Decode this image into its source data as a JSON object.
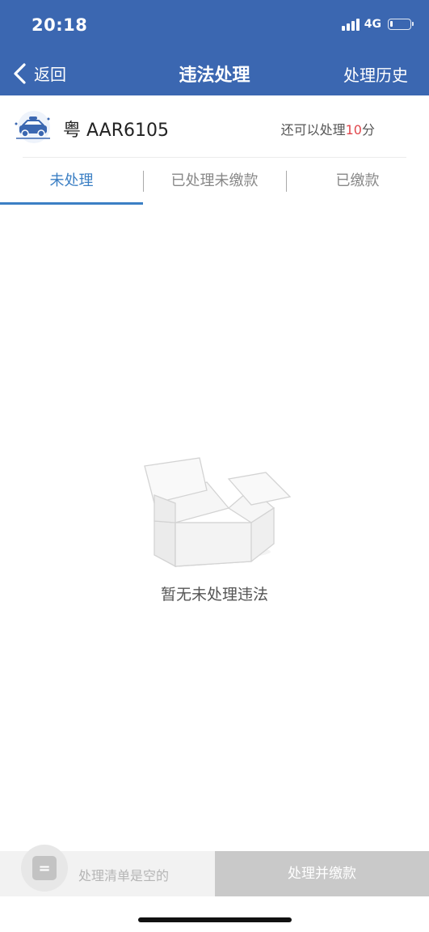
{
  "status_bar": {
    "time": "20:18",
    "network": "4G"
  },
  "nav": {
    "back_label": "返回",
    "title": "违法处理",
    "history_label": "处理历史"
  },
  "vehicle": {
    "plate": "粤 AAR6105",
    "points_prefix": "还可以处理",
    "points_value": "10",
    "points_suffix": "分"
  },
  "tabs": [
    {
      "label": "未处理",
      "active": true
    },
    {
      "label": "已处理未缴款",
      "active": false
    },
    {
      "label": "已缴款",
      "active": false
    }
  ],
  "empty_state": {
    "message": "暂无未处理违法"
  },
  "bottom": {
    "cart_text": "处理清单是空的",
    "cart_glyph": "=",
    "pay_button": "处理并缴款"
  },
  "colors": {
    "header": "#3b67b1",
    "tab_active": "#3b7fc4",
    "points_highlight": "#e0474c",
    "pay_button_disabled": "#c9c9c9"
  }
}
